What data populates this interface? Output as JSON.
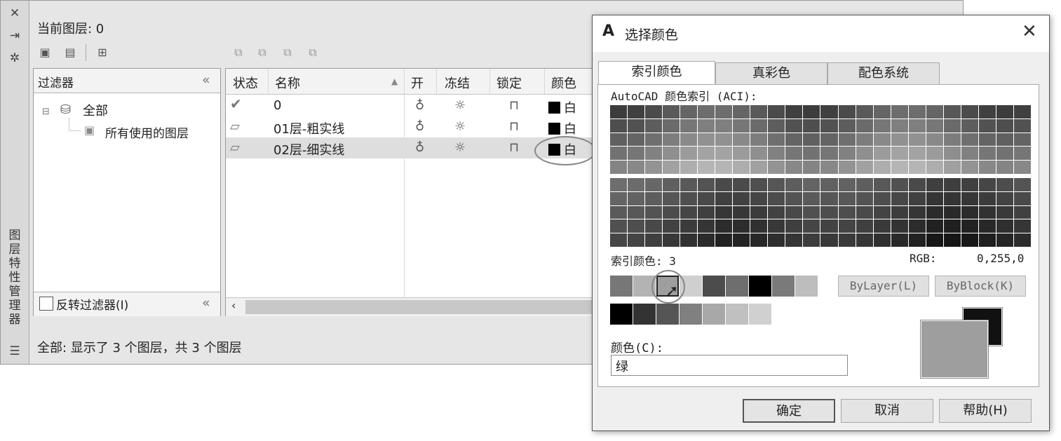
{
  "layer_manager": {
    "side_title": "图层特性管理器",
    "current_layer": "当前图层: 0",
    "filter_panel": {
      "title": "过滤器",
      "tree_all": "全部",
      "tree_used": "所有使用的图层",
      "invert_label": "反转过滤器(I)"
    },
    "columns": [
      "状态",
      "名称",
      "开",
      "冻结",
      "锁定",
      "颜色"
    ],
    "rows": [
      {
        "name": "0",
        "color": "白"
      },
      {
        "name": "01层-粗实线",
        "color": "白"
      },
      {
        "name": "02层-细实线",
        "color": "白"
      }
    ],
    "status": "全部: 显示了 3 个图层，共 3 个图层"
  },
  "dialog": {
    "title": "选择颜色",
    "tabs": [
      "索引颜色",
      "真彩色",
      "配色系统"
    ],
    "aci_label": "AutoCAD 颜色索引 (ACI):",
    "index_label": "索引颜色:",
    "index_value": "3",
    "rgb_label": "RGB:",
    "rgb_value": "0,255,0",
    "bylayer": "ByLayer(L)",
    "byblock": "ByBlock(K)",
    "color_label": "颜色(C):",
    "color_value": "绿",
    "buttons": {
      "ok": "确定",
      "cancel": "取消",
      "help": "帮助(H)"
    }
  },
  "colors": {
    "standard_swatches": [
      "#777777",
      "#b3b3b3",
      "#9e9e9e",
      "#cfcfcf",
      "#4c4c4c",
      "#6e6e6e",
      "#000000",
      "#7a7a7a",
      "#bdbdbd"
    ],
    "gray_swatches": [
      "#000000",
      "#333333",
      "#555555",
      "#808080",
      "#a8a8a8",
      "#c0c0c0",
      "#d0d0d0"
    ]
  }
}
